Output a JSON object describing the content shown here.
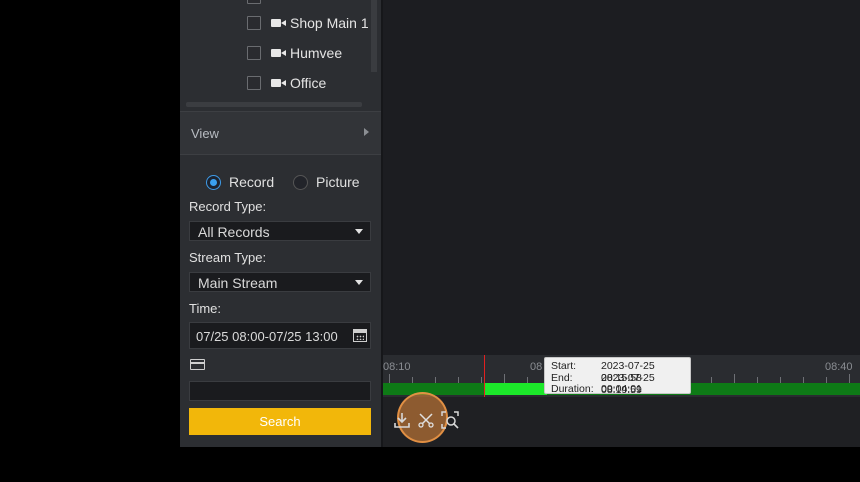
{
  "tree": {
    "items": [
      {
        "label": "Shop Main 1"
      },
      {
        "label": "Humvee"
      },
      {
        "label": "Office"
      }
    ]
  },
  "view": {
    "label": "View"
  },
  "mode": {
    "record_label": "Record",
    "picture_label": "Picture",
    "selected": "Record"
  },
  "record_type": {
    "label": "Record Type:",
    "value": "All Records"
  },
  "stream_type": {
    "label": "Stream Type:",
    "value": "Main Stream"
  },
  "time": {
    "label": "Time:",
    "value": "07/25 08:00-07/25 13:00"
  },
  "card": {
    "value": ""
  },
  "search": {
    "label": "Search"
  },
  "timeline": {
    "labels": [
      "08:10",
      "08",
      "08:40"
    ],
    "tooltip": {
      "start_key": "Start:",
      "start_val": "2023-07-25 08:15:58",
      "end_key": "End:",
      "end_val": "2023-07-25 08:19:59",
      "duration_key": "Duration:",
      "duration_val": "00:04:01"
    }
  },
  "colors": {
    "accent": "#f2b70a",
    "record_bar": "#0e7a16",
    "record_highlight": "#1ce82a",
    "cursor": "#e02020"
  }
}
